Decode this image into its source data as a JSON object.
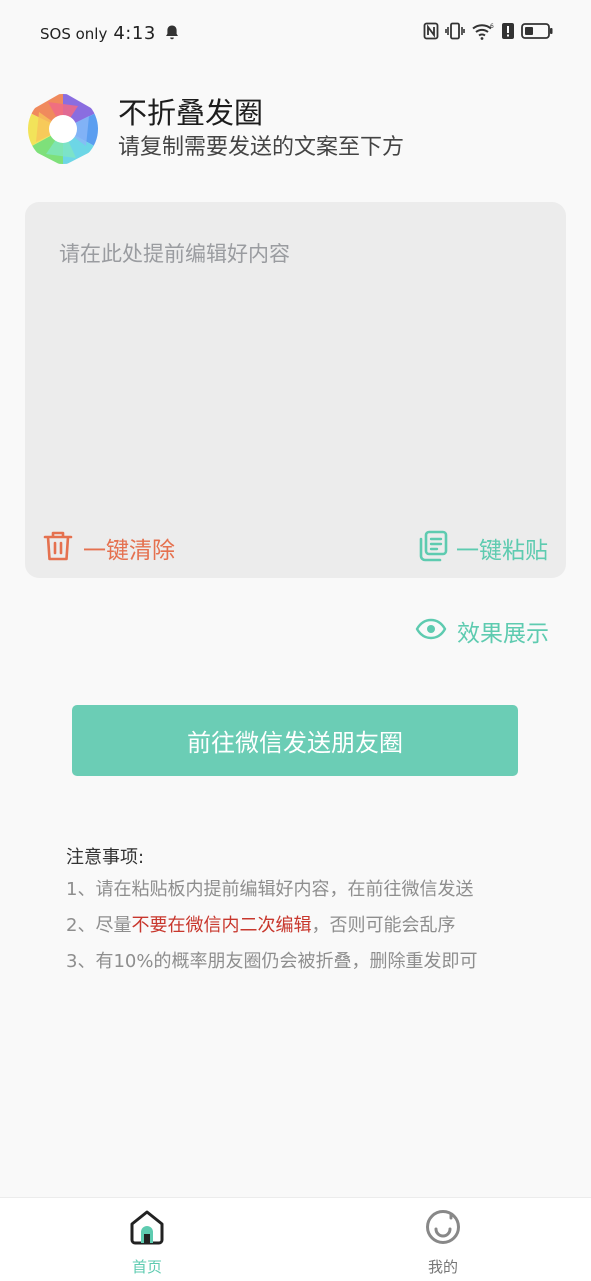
{
  "status_bar": {
    "carrier": "SOS only",
    "time": "4:13",
    "icons": [
      "bell-icon",
      "nfc-icon",
      "vibrate-icon",
      "wifi-icon",
      "alert-icon",
      "battery-icon"
    ]
  },
  "header": {
    "logo_icon": "aperture-logo-icon",
    "title": "不折叠发圈",
    "subtitle": "请复制需要发送的文案至下方"
  },
  "editor": {
    "placeholder": "请在此处提前编辑好内容",
    "value": "",
    "clear_label": "一键清除",
    "clear_icon": "trash-icon",
    "paste_label": "一键粘贴",
    "paste_icon": "clipboard-icon"
  },
  "preview": {
    "label": "效果展示",
    "icon": "eye-icon"
  },
  "main_button": {
    "label": "前往微信发送朋友圈"
  },
  "notes": {
    "title": "注意事项:",
    "line1": "1、请在粘贴板内提前编辑好内容，在前往微信发送",
    "line2_prefix": "2、尽量",
    "line2_highlight": "不要在微信内二次编辑",
    "line2_suffix": "，否则可能会乱序",
    "line3": "3、有10%的概率朋友圈仍会被折叠，删除重发即可"
  },
  "bottom_nav": {
    "items": [
      {
        "label": "首页",
        "icon": "home-icon",
        "active": true
      },
      {
        "label": "我的",
        "icon": "smile-icon",
        "active": false
      }
    ]
  },
  "colors": {
    "accent": "#6bcdb5",
    "accent_text": "#5ecbb0",
    "danger": "#e5714f",
    "highlight": "#c8372d",
    "card_bg": "#ececec",
    "page_bg": "#f9f9f9"
  }
}
